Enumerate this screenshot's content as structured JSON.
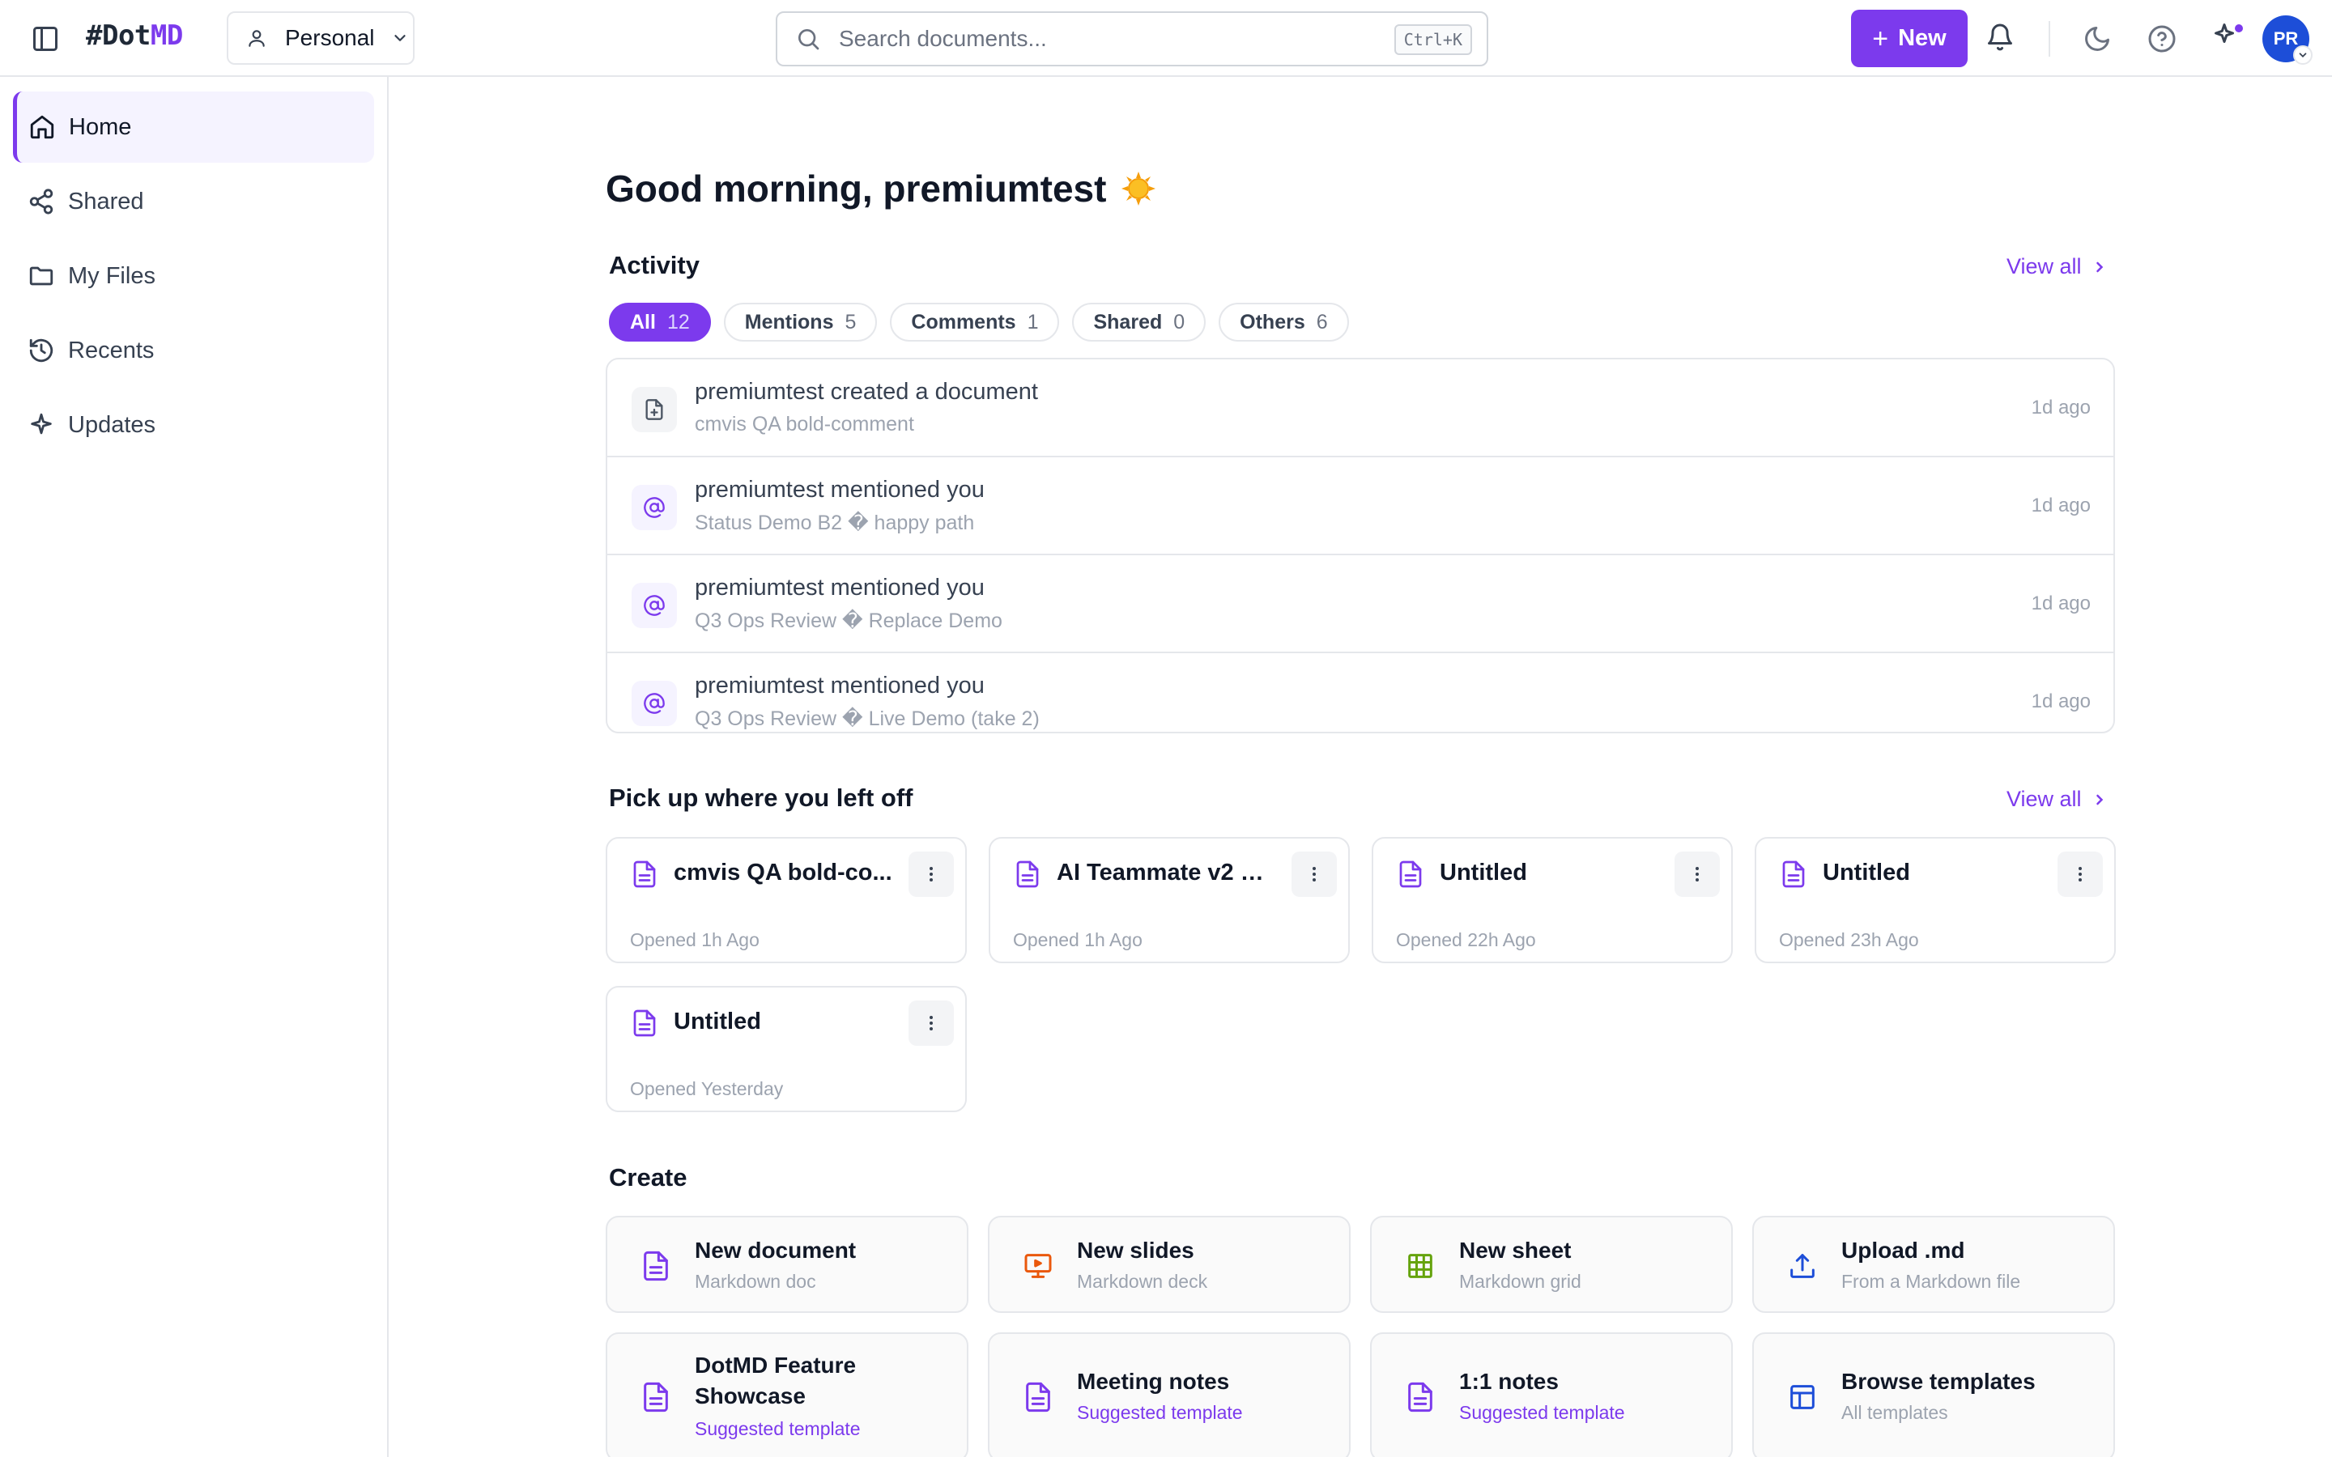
{
  "header": {
    "logo_hash": "#Dot",
    "logo_accent": "MD",
    "workspace": "Personal",
    "search_placeholder": "Search documents...",
    "search_shortcut": "Ctrl+K",
    "new_label": "New",
    "avatar_initials": "PR",
    "accent_color": "#7c3aed"
  },
  "sidebar": {
    "items": [
      {
        "label": "Home",
        "icon": "home-icon",
        "active": true
      },
      {
        "label": "Shared",
        "icon": "share-icon"
      },
      {
        "label": "My Files",
        "icon": "folder-icon"
      },
      {
        "label": "Recents",
        "icon": "history-icon"
      },
      {
        "label": "Updates",
        "icon": "sparkle-icon"
      }
    ]
  },
  "main": {
    "greeting": "Good morning, premiumtest",
    "activity": {
      "title": "Activity",
      "view_all": "View all",
      "filters": [
        {
          "label": "All",
          "count": "12"
        },
        {
          "label": "Mentions",
          "count": "5"
        },
        {
          "label": "Comments",
          "count": "1"
        },
        {
          "label": "Shared",
          "count": "0"
        },
        {
          "label": "Others",
          "count": "6"
        }
      ],
      "items": [
        {
          "title": "premiumtest created a document",
          "subtitle": "cmvis QA bold-comment",
          "time": "1d ago",
          "icon": "file-plus-icon"
        },
        {
          "title": "premiumtest mentioned you",
          "subtitle": "Status Demo B2 � happy path",
          "time": "1d ago",
          "icon": "at-sign-icon"
        },
        {
          "title": "premiumtest mentioned you",
          "subtitle": "Q3 Ops Review � Replace Demo",
          "time": "1d ago",
          "icon": "at-sign-icon"
        },
        {
          "title": "premiumtest mentioned you",
          "subtitle": "Q3 Ops Review � Live Demo (take 2)",
          "time": "1d ago",
          "icon": "at-sign-icon"
        }
      ]
    },
    "recent": {
      "title": "Pick up where you left off",
      "view_all": "View all",
      "docs": [
        {
          "title": "cmvis QA bold-co...",
          "opened": "Opened 1h Ago"
        },
        {
          "title": "AI Teammate v2 —...",
          "opened": "Opened 1h Ago"
        },
        {
          "title": "Untitled",
          "opened": "Opened 22h Ago"
        },
        {
          "title": "Untitled",
          "opened": "Opened 23h Ago"
        },
        {
          "title": "Untitled",
          "opened": "Opened Yesterday"
        }
      ]
    },
    "create": {
      "title": "Create",
      "items": [
        {
          "title": "New document",
          "subtitle": "Markdown doc",
          "icon": "document-icon"
        },
        {
          "title": "New slides",
          "subtitle": "Markdown deck",
          "icon": "presentation-icon"
        },
        {
          "title": "New sheet",
          "subtitle": "Markdown grid",
          "icon": "grid-icon"
        },
        {
          "title": "Upload .md",
          "subtitle": "From a Markdown file",
          "icon": "upload-icon"
        },
        {
          "title": "DotMD Feature Showcase",
          "subtitle": "Suggested template",
          "icon": "document-icon"
        },
        {
          "title": "Meeting notes",
          "subtitle": "Suggested template",
          "icon": "document-icon"
        },
        {
          "title": "1:1 notes",
          "subtitle": "Suggested template",
          "icon": "document-icon"
        },
        {
          "title": "Browse templates",
          "subtitle": "All templates",
          "icon": "layout-icon"
        }
      ]
    }
  }
}
